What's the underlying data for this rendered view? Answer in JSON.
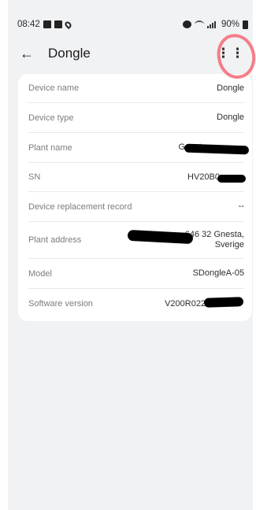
{
  "status_bar": {
    "time": "08:42",
    "battery_text": "90%"
  },
  "header": {
    "title": "Dongle",
    "back_icon": "arrow-left-icon",
    "more_icon": "more-dots-icon"
  },
  "device_info": {
    "rows": [
      {
        "label": "Device name",
        "value": "Dongle"
      },
      {
        "label": "Device type",
        "value": "Dongle"
      },
      {
        "label": "Plant name",
        "value": "Gnesta"
      },
      {
        "label": "SN",
        "value": "HV20B0"
      },
      {
        "label": "Device replacement record",
        "value": "--"
      },
      {
        "label": "Plant address",
        "value": "646 32 Gnesta,\nSverige"
      },
      {
        "label": "Model",
        "value": "SDongleA-05"
      },
      {
        "label": "Software version",
        "value": "V200R022C"
      }
    ]
  },
  "colors": {
    "annotation": "#f26d79",
    "background": "#f1f2f4",
    "card": "#ffffff"
  }
}
